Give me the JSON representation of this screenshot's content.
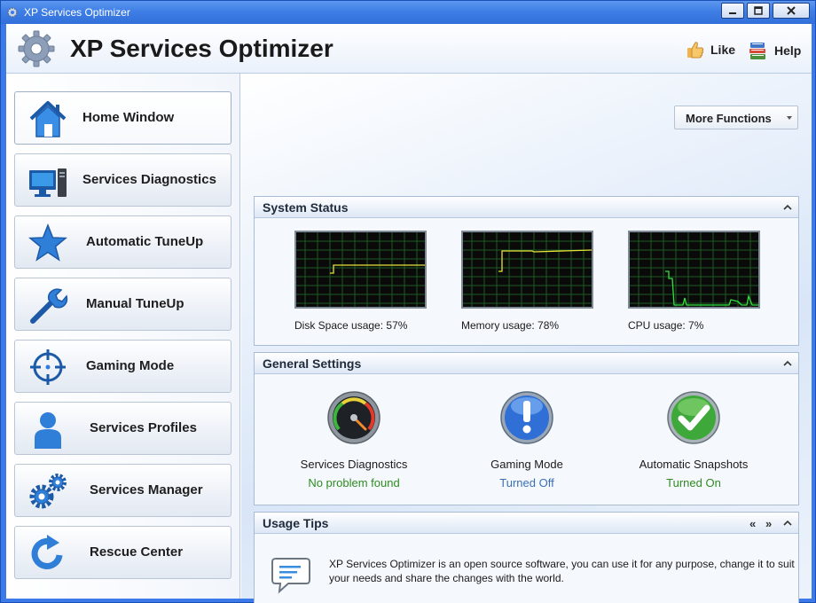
{
  "window": {
    "title": "XP Services Optimizer",
    "accent": "#3b7ae8"
  },
  "header": {
    "app_title": "XP Services Optimizer",
    "like_label": "Like",
    "help_label": "Help"
  },
  "sidebar": {
    "items": [
      {
        "label": "Home Window",
        "icon": "home-icon"
      },
      {
        "label": "Services Diagnostics",
        "icon": "computer-icon"
      },
      {
        "label": "Automatic TuneUp",
        "icon": "star-icon"
      },
      {
        "label": "Manual TuneUp",
        "icon": "wrench-icon"
      },
      {
        "label": "Gaming Mode",
        "icon": "crosshair-icon"
      },
      {
        "label": "Services Profiles",
        "icon": "user-icon"
      },
      {
        "label": "Services Manager",
        "icon": "gears-icon"
      },
      {
        "label": "Rescue Center",
        "icon": "refresh-icon"
      }
    ]
  },
  "toolbar": {
    "more_functions_label": "More Functions"
  },
  "system_status": {
    "title": "System Status",
    "disk_label": "Disk Space usage: 57%",
    "memory_label": "Memory usage: 78%",
    "cpu_label": "CPU usage: 7%",
    "disk_percent": 57,
    "memory_percent": 78,
    "cpu_percent": 7
  },
  "general_settings": {
    "title": "General Settings",
    "items": [
      {
        "name": "Services Diagnostics",
        "value": "No problem found",
        "color": "#2e8b1f"
      },
      {
        "name": "Gaming Mode",
        "value": "Turned Off",
        "color": "#3b6fb6"
      },
      {
        "name": "Automatic Snapshots",
        "value": "Turned On",
        "color": "#2e8b1f"
      }
    ]
  },
  "usage_tips": {
    "title": "Usage Tips",
    "prev": "«",
    "next": "»",
    "text": "XP Services Optimizer is an open source software, you can use it for any purpose, change it to suit your needs and share the changes with the world."
  }
}
